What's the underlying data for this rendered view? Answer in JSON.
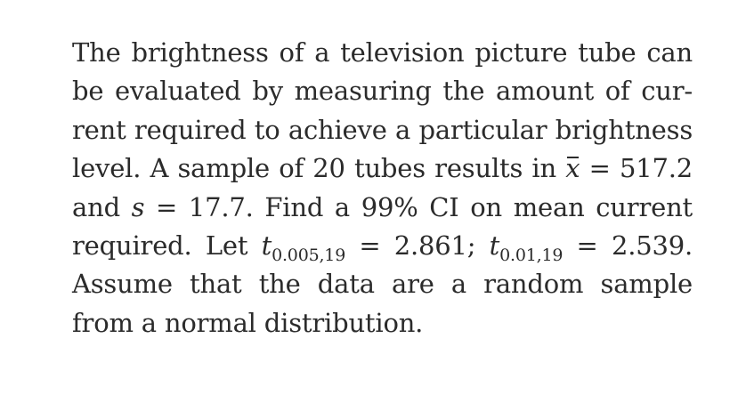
{
  "document": {
    "lines": [
      {
        "text": "The brightness of a television picture tube can"
      },
      {
        "text": "be evaluated by measuring the amount of cur-"
      },
      {
        "text": "rent required to achieve a particular brightness"
      },
      {
        "prefix": "level. A sample of 20 tubes results in ",
        "var": "x",
        "suffix": " = 517.2"
      },
      {
        "prefix": "and ",
        "var": "s",
        "suffix": " = 17.7. Find a 99% CI on mean current"
      },
      {
        "prefix": "required. Let ",
        "t1_var": "t",
        "t1_sub": "0.005,19",
        "middle": " = 2.861; ",
        "t2_var": "t",
        "t2_sub": "0.01,19",
        "suffix": " = 2.539."
      },
      {
        "text": "Assume that the data are a random sample"
      },
      {
        "text": "from a normal distribution."
      }
    ]
  }
}
